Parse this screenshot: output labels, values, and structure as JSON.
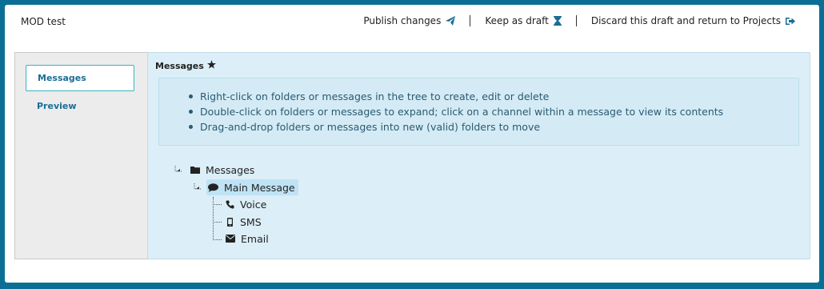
{
  "header": {
    "project_title": "MOD test",
    "actions": {
      "publish": "Publish changes",
      "draft": "Keep as draft",
      "discard": "Discard this draft and return to Projects"
    }
  },
  "sidebar": {
    "items": [
      {
        "label": "Messages",
        "active": true
      },
      {
        "label": "Preview",
        "active": false
      }
    ]
  },
  "main": {
    "title": "Messages",
    "tips": [
      "Right-click on folders or messages in the tree to create, edit or delete",
      "Double-click on folders or messages to expand; click on a channel within a message to view its contents",
      "Drag-and-drop folders or messages into new (valid) folders to move"
    ],
    "tree": {
      "root": {
        "label": "Messages",
        "icon": "folder-icon"
      },
      "message": {
        "label": "Main Message",
        "icon": "comment-icon",
        "selected": true
      },
      "channels": [
        {
          "label": "Voice",
          "icon": "phone-icon"
        },
        {
          "label": "SMS",
          "icon": "mobile-icon"
        },
        {
          "label": "Email",
          "icon": "envelope-icon"
        }
      ]
    }
  },
  "colors": {
    "frame_border": "#0b6f95",
    "accent": "#1a6e96",
    "active_border": "#36b5c6",
    "panel_bg": "#dceef7",
    "selected_bg": "#bfe3f5"
  }
}
